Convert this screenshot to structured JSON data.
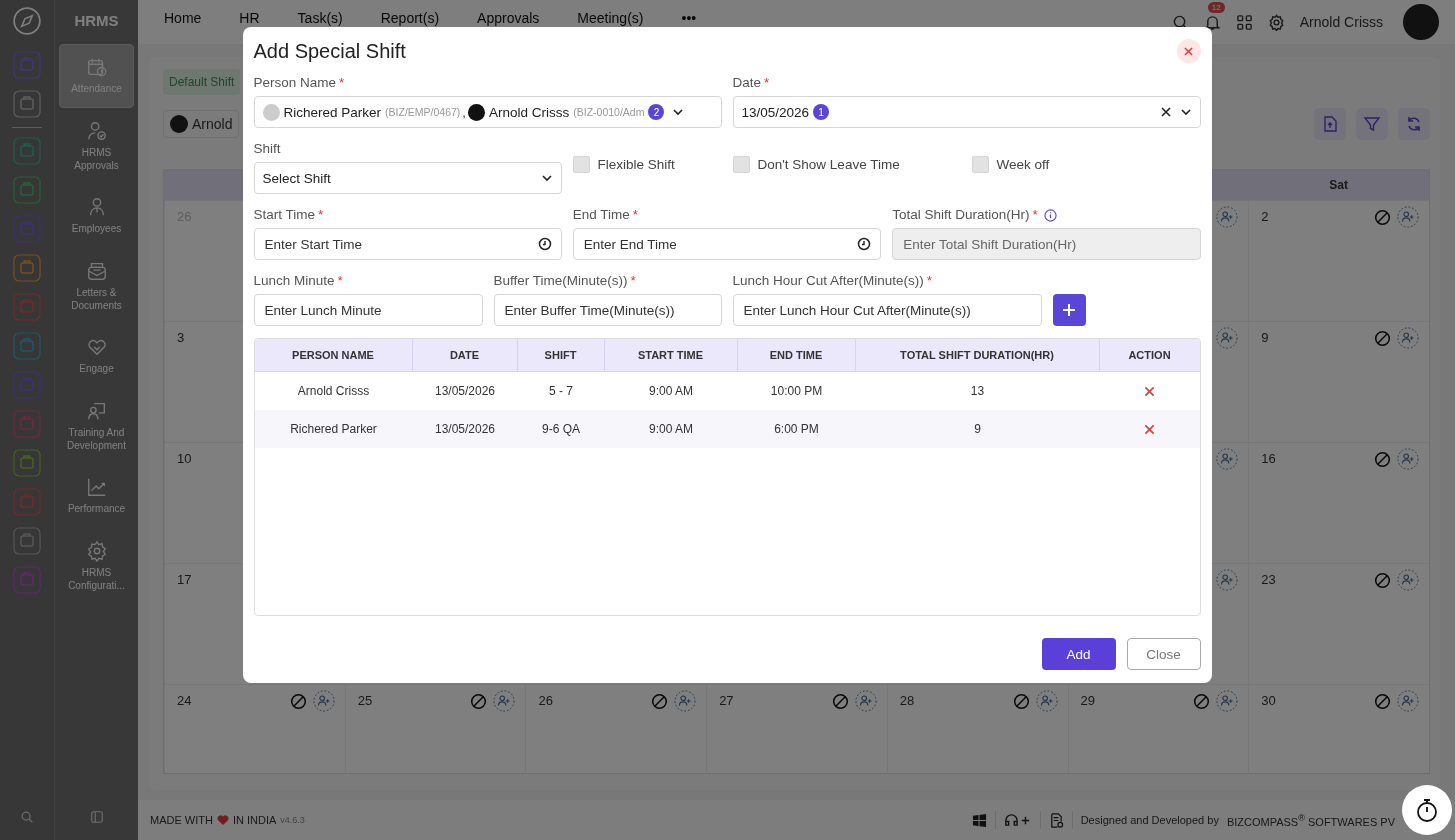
{
  "topbar": {
    "brand": "HRMS",
    "menu": [
      "Home",
      "HR",
      "Task(s)",
      "Report(s)",
      "Approvals",
      "Meeting(s)",
      "•••"
    ],
    "notification_count": "12",
    "user_name": "Arnold Crisss"
  },
  "sidebar": {
    "items": [
      {
        "label": "Attendance",
        "kind": "calendar",
        "selected": true
      },
      {
        "label": "HRMS Approvals",
        "kind": "approval",
        "selected": false
      },
      {
        "label": "Employees",
        "kind": "person",
        "selected": false
      },
      {
        "label": "Letters & Documents",
        "kind": "letter",
        "selected": false
      },
      {
        "label": "Engage",
        "kind": "handshake",
        "selected": false
      },
      {
        "label": "Training And Development",
        "kind": "training",
        "selected": false
      },
      {
        "label": "Performance",
        "kind": "chart",
        "selected": false
      },
      {
        "label": "HRMS Configurati...",
        "kind": "gear",
        "selected": false
      }
    ]
  },
  "content": {
    "shift_tab": "Default Shift",
    "employee": "Arnold",
    "calendar": {
      "weekday_label": "Sat",
      "weeks": [
        {
          "first": {
            "day": "26",
            "muted": true
          },
          "friday_add": true,
          "last": {
            "day": "2",
            "muted": false
          }
        },
        {
          "first": {
            "day": "3",
            "muted": false
          },
          "friday_add": true,
          "last": {
            "day": "9",
            "muted": false
          }
        },
        {
          "first": {
            "day": "10",
            "muted": false
          },
          "friday_add": true,
          "last": {
            "day": "16",
            "muted": false
          }
        },
        {
          "first": {
            "day": "17",
            "muted": false
          },
          "friday_add": true,
          "last": {
            "day": "23",
            "muted": false
          }
        }
      ],
      "last_week": [
        {
          "day": "24",
          "muted": false
        },
        {
          "day": "25",
          "muted": false
        },
        {
          "day": "26",
          "muted": false
        },
        {
          "day": "27",
          "muted": false
        },
        {
          "day": "28",
          "muted": false
        },
        {
          "day": "29",
          "muted": false
        },
        {
          "day": "30",
          "muted": false
        }
      ]
    }
  },
  "footer": {
    "made_with": "MADE WITH",
    "in_india": "IN INDIA",
    "version": "v4.6.3",
    "credit": "Designed and Developed by",
    "company": "BIZCOMPASS$^{®}$ SOFTWARES PV"
  },
  "modal": {
    "title": "Add Special Shift",
    "required_mark": "*",
    "person_field": {
      "label": "Person Name",
      "required": true,
      "chips": [
        {
          "name": "Richered Parker",
          "code": "(BIZ/EMP/0467)",
          "kind": "light"
        },
        {
          "name": "Arnold Crisss",
          "code": "(BIZ-0010/Adm",
          "kind": "dark"
        }
      ],
      "separator": ",",
      "count": "2"
    },
    "date_field": {
      "label": "Date",
      "required": true,
      "value": "13/05/2026",
      "count": "1"
    },
    "shift_field": {
      "label": "Shift",
      "required": false,
      "placeholder": "Select Shift"
    },
    "checkboxes": [
      {
        "label": "Flexible Shift",
        "checked": false
      },
      {
        "label": "Don't Show Leave Time",
        "checked": false
      },
      {
        "label": "Week off",
        "checked": false
      }
    ],
    "time_fields": [
      {
        "label": "Start Time",
        "required": true,
        "placeholder": "Enter Start Time",
        "kind": "time",
        "disabled": false,
        "info": false
      },
      {
        "label": "End Time",
        "required": true,
        "placeholder": "Enter End Time",
        "kind": "time",
        "disabled": false,
        "info": false
      },
      {
        "label": "Total Shift Duration(Hr)",
        "required": true,
        "placeholder": "Enter Total Shift Duration(Hr)",
        "kind": "text",
        "disabled": true,
        "info": true
      }
    ],
    "minute_fields": [
      {
        "label": "Lunch Minute",
        "required": true,
        "placeholder": "Enter Lunch Minute"
      },
      {
        "label": "Buffer Time(Minute(s))",
        "required": true,
        "placeholder": "Enter Buffer Time(Minute(s))"
      },
      {
        "label": "Lunch Hour Cut After(Minute(s))",
        "required": true,
        "placeholder": "Enter Lunch Hour Cut After(Minute(s))"
      }
    ],
    "table": {
      "columns": [
        "PERSON NAME",
        "DATE",
        "SHIFT",
        "START TIME",
        "END TIME",
        "TOTAL SHIFT DURATION(HR)",
        "ACTION"
      ],
      "rows": [
        {
          "cells": [
            "Arnold Crisss",
            "13/05/2026",
            "5 - 7",
            "9:00 AM",
            "10:00 PM",
            "13"
          ]
        },
        {
          "cells": [
            "Richered Parker",
            "13/05/2026",
            "9-6 QA",
            "9:00 AM",
            "6:00 PM",
            "9"
          ]
        }
      ]
    },
    "buttons": [
      {
        "label": "Add",
        "kind": "primary"
      },
      {
        "label": "Close",
        "kind": "secondary"
      }
    ]
  }
}
